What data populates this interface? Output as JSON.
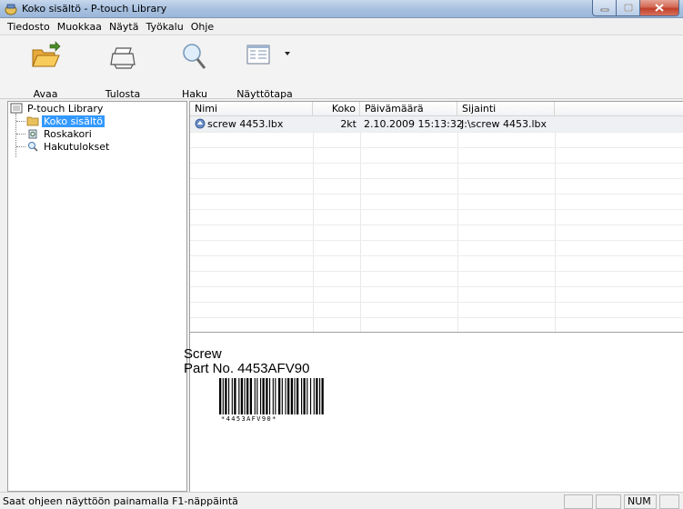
{
  "window": {
    "title": "Koko sisältö - P-touch Library"
  },
  "menu": {
    "items": [
      "Tiedosto",
      "Muokkaa",
      "Näytä",
      "Työkalu",
      "Ohje"
    ]
  },
  "toolbar": {
    "open_label": "Avaa",
    "print_label": "Tulosta",
    "search_label": "Haku",
    "view_label": "Näyttötapa"
  },
  "tree": {
    "root": "P-touch Library",
    "items": [
      "Koko sisältö",
      "Roskakori",
      "Hakutulokset"
    ],
    "selected_index": 0
  },
  "list": {
    "columns": [
      "Nimi",
      "Koko",
      "Päivämäärä",
      "Sijainti"
    ],
    "rows": [
      {
        "name": "screw 4453.lbx",
        "size": "2kt",
        "date": "2.10.2009 15:13:32",
        "location": "J:\\screw 4453.lbx"
      }
    ]
  },
  "preview": {
    "line1": "Screw",
    "line2": "Part No. 4453AFV90",
    "barcode_text": "*4453AFV90*"
  },
  "statusbar": {
    "message": "Saat ohjeen näyttöön painamalla F1-näppäintä",
    "num_indicator": "NUM"
  },
  "colors": {
    "selection": "#3399ff",
    "titlebar": "#a9c2e1",
    "close_button": "#c1402a"
  }
}
